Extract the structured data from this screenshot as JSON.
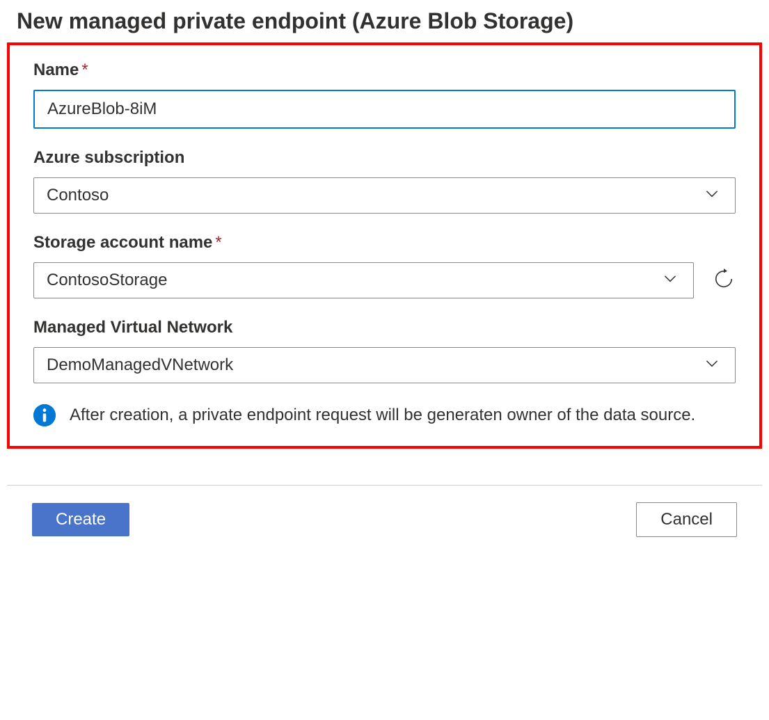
{
  "heading": "New managed private endpoint (Azure Blob Storage)",
  "form": {
    "name": {
      "label": "Name",
      "required_marker": "*",
      "value": "AzureBlob-8iM"
    },
    "subscription": {
      "label": "Azure subscription",
      "value": "Contoso"
    },
    "storage_account": {
      "label": "Storage account name",
      "required_marker": "*",
      "value": "ContosoStorage"
    },
    "managed_vnet": {
      "label": "Managed Virtual Network",
      "value": "DemoManagedVNetwork"
    },
    "info_text": "After creation, a private endpoint request will be generaten owner of the data source."
  },
  "actions": {
    "create": "Create",
    "cancel": "Cancel"
  },
  "icons": {
    "chevron_down": "chevron-down-icon",
    "refresh": "refresh-icon",
    "info": "info-icon"
  }
}
